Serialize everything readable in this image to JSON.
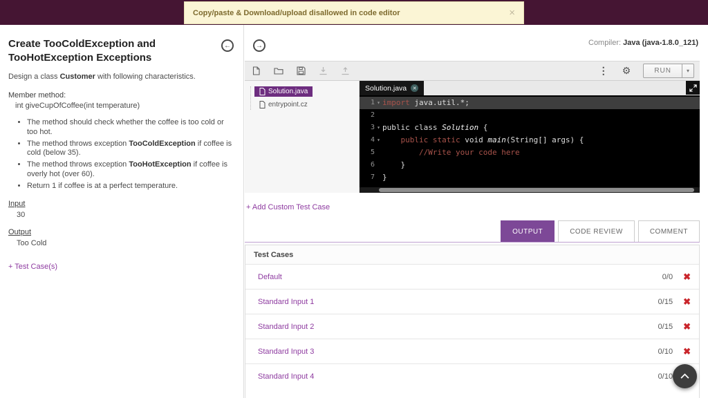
{
  "colors": {
    "header_bar": "#451533",
    "accent_link": "#8e3ba0",
    "active_tab_bg": "#7d4897",
    "selected_file_bg": "#6d2d7f",
    "banner_bg": "#fbf5d5",
    "banner_text": "#7d6a2e",
    "fail_red": "#c9252b",
    "editor_bg": "#000000",
    "keyword_color": "#a9534b"
  },
  "banner": {
    "text": "Copy/paste & Download/upload disallowed in code editor"
  },
  "icons": {
    "close": "×",
    "tab_close": "✕",
    "kebab": "⋮",
    "gear": "⚙",
    "caret_down": "▾",
    "back_arrow": "←",
    "forward_arrow": "→",
    "fail": "✖"
  },
  "problem": {
    "title": "Create TooColdException and TooHotException Exceptions",
    "intro_pre": "Design a class ",
    "intro_bold": "Customer",
    "intro_post": " with following characteristics.",
    "member_method_label": "Member method:",
    "member_method_signature": "int giveCupOfCoffee(int temperature)",
    "bullets": [
      {
        "pre": "The method should check whether the coffee is too cold or too hot.",
        "bold": "",
        "post": ""
      },
      {
        "pre": "The method throws exception ",
        "bold": "TooColdException",
        "post": " if coffee is cold (below 35)."
      },
      {
        "pre": "The method throws exception ",
        "bold": "TooHotException",
        "post": " if coffee is overly hot (over 60)."
      },
      {
        "pre": "Return 1 if coffee is at a perfect temperature.",
        "bold": "",
        "post": ""
      }
    ],
    "input_label": "Input",
    "input_value": "30",
    "output_label": "Output",
    "output_value": "Too Cold",
    "test_cases_link": "+ Test Case(s)"
  },
  "compiler": {
    "label": "Compiler: ",
    "value": "Java (java-1.8.0_121)"
  },
  "toolbar": {
    "run_label": "RUN"
  },
  "files": [
    {
      "name": "Solution.java",
      "selected": true
    },
    {
      "name": "entrypoint.cz",
      "selected": false
    }
  ],
  "editor": {
    "tab_label": "Solution.java",
    "lines": [
      {
        "num": "1",
        "fold": true,
        "active": true,
        "tokens": [
          {
            "t": "import",
            "c": "kw"
          },
          {
            "t": " java.util.*;",
            "c": "pln"
          }
        ]
      },
      {
        "num": "2",
        "fold": false,
        "active": false,
        "tokens": []
      },
      {
        "num": "3",
        "fold": true,
        "active": false,
        "tokens": [
          {
            "t": "public class ",
            "c": "pln"
          },
          {
            "t": "Solution",
            "c": "cls"
          },
          {
            "t": " {",
            "c": "pln"
          }
        ]
      },
      {
        "num": "4",
        "fold": true,
        "active": false,
        "tokens": [
          {
            "t": "    ",
            "c": "pln"
          },
          {
            "t": "public static",
            "c": "kw"
          },
          {
            "t": " void ",
            "c": "pln"
          },
          {
            "t": "main",
            "c": "fn"
          },
          {
            "t": "(String[] args) {",
            "c": "pln"
          }
        ]
      },
      {
        "num": "5",
        "fold": false,
        "active": false,
        "tokens": [
          {
            "t": "        ",
            "c": "pln"
          },
          {
            "t": "//Write your code here",
            "c": "cmt"
          }
        ]
      },
      {
        "num": "6",
        "fold": false,
        "active": false,
        "tokens": [
          {
            "t": "    }",
            "c": "pln"
          }
        ]
      },
      {
        "num": "7",
        "fold": false,
        "active": false,
        "tokens": [
          {
            "t": "}",
            "c": "pln"
          }
        ]
      }
    ]
  },
  "add_custom_label": "+ Add Custom Test Case",
  "output_tabs": {
    "items": [
      "OUTPUT",
      "CODE REVIEW",
      "COMMENT"
    ],
    "active": "OUTPUT"
  },
  "test_cases": {
    "title": "Test Cases",
    "rows": [
      {
        "label": "Default",
        "score": "0/0"
      },
      {
        "label": "Standard Input 1",
        "score": "0/15"
      },
      {
        "label": "Standard Input 2",
        "score": "0/15"
      },
      {
        "label": "Standard Input 3",
        "score": "0/10"
      },
      {
        "label": "Standard Input 4",
        "score": "0/10"
      }
    ]
  }
}
